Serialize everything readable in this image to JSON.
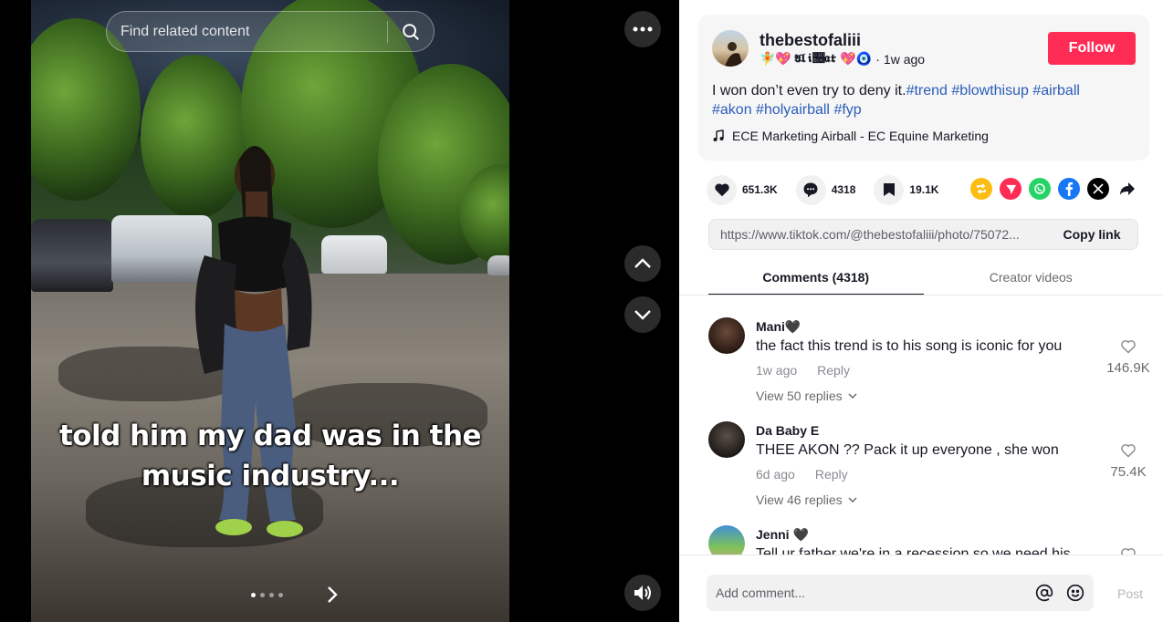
{
  "search": {
    "placeholder": "Find related content"
  },
  "post": {
    "username": "thebestofaliii",
    "nickname_emoji_left": "🧚💖",
    "nickname": "𝔄𝔩𝔦𝔆𝔞𝔱",
    "nickname_emoji_right": "💖🧿",
    "time_ago": "1w ago",
    "follow_label": "Follow",
    "description_text": "I won don’t even try to deny it.",
    "hashtags": [
      "#trend",
      "#blowthisup",
      "#airball",
      "#akon",
      "#holyairball",
      "#fyp"
    ],
    "music": "ECE Marketing Airball - EC Equine Marketing",
    "caption_line1": "told him my dad was in the",
    "caption_line2": "music industry..."
  },
  "stats": {
    "likes": "651.3K",
    "comments": "4318",
    "saves": "19.1K"
  },
  "share": {
    "link": "https://www.tiktok.com/@thebestofaliii/photo/75072...",
    "copy_label": "Copy link"
  },
  "tabs": [
    {
      "label": "Comments (4318)",
      "active": true
    },
    {
      "label": "Creator videos",
      "active": false
    }
  ],
  "comments": [
    {
      "name": "Mani🖤",
      "text": "the fact this trend is to his song is iconic for you",
      "time": "1w ago",
      "reply": "Reply",
      "replies": "View 50 replies",
      "likes": "146.9K"
    },
    {
      "name": "Da Baby E",
      "text": "THEE AKON ?? Pack it up everyone , she won",
      "time": "6d ago",
      "reply": "Reply",
      "replies": "View 46 replies",
      "likes": "75.4K"
    },
    {
      "name": "Jenni 🖤",
      "text": "Tell ur father we're in a recession so we need his",
      "time": "",
      "reply": "",
      "replies": "",
      "likes": ""
    }
  ],
  "composer": {
    "placeholder": "Add comment...",
    "post_label": "Post"
  },
  "colors": {
    "follow": "#fe2c55",
    "hashtag": "#2b5db9",
    "panel_bg": "#ffffff",
    "stage_bg": "#000000"
  }
}
